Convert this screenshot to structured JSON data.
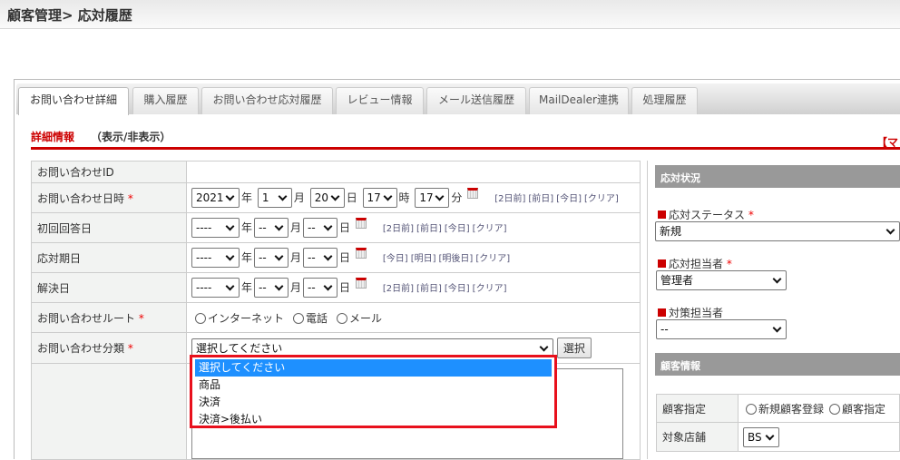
{
  "header": {
    "title": "顧客管理> 応対履歴"
  },
  "tabs": [
    {
      "label": "お問い合わせ詳細"
    },
    {
      "label": "購入履歴"
    },
    {
      "label": "お問い合わせ応対履歴"
    },
    {
      "label": "レビュー情報"
    },
    {
      "label": "メール送信履歴"
    },
    {
      "label": "MailDealer連携"
    },
    {
      "label": "処理履歴"
    }
  ],
  "section": {
    "title": "詳細情報",
    "toggle": "（表示/非表示）",
    "mark": "【マ"
  },
  "units": {
    "year": "年",
    "month": "月",
    "day": "日",
    "hour": "時",
    "minute": "分"
  },
  "form": {
    "id_label": "お問い合わせID",
    "datetime": {
      "label": "お問い合わせ日時",
      "year": "2021",
      "month": "1",
      "day": "20",
      "hour": "17",
      "minute": "17",
      "links": [
        "[2日前]",
        "[前日]",
        "[今日]",
        "[クリア]"
      ]
    },
    "first_reply": {
      "label": "初回回答日",
      "year": "----",
      "month": "--",
      "day": "--",
      "links": [
        "[2日前]",
        "[前日]",
        "[今日]",
        "[クリア]"
      ]
    },
    "due": {
      "label": "応対期日",
      "year": "----",
      "month": "--",
      "day": "--",
      "links": [
        "[今日]",
        "[明日]",
        "[明後日]",
        "[クリア]"
      ]
    },
    "resolved": {
      "label": "解決日",
      "year": "----",
      "month": "--",
      "day": "--",
      "links": [
        "[2日前]",
        "[前日]",
        "[今日]",
        "[クリア]"
      ]
    },
    "route": {
      "label": "お問い合わせルート",
      "options": [
        "インターネット",
        "電話",
        "メール"
      ]
    },
    "category": {
      "label": "お問い合わせ分類",
      "value": "選択してください",
      "button": "選択",
      "options": [
        "選択してください",
        "商品",
        "決済",
        "決済>後払い"
      ]
    },
    "required_mark": "*"
  },
  "right": {
    "status_header": "応対状況",
    "status": {
      "label": "応対ステータス",
      "value": "新規"
    },
    "assignee": {
      "label": "応対担当者",
      "value": "管理者"
    },
    "measure": {
      "label": "対策担当者",
      "value": "--"
    },
    "customer_header": "顧客情報",
    "customer_spec": {
      "label": "顧客指定",
      "options": [
        "新規顧客登録",
        "顧客指定"
      ]
    },
    "store": {
      "label": "対象店舗",
      "value": "BS"
    }
  }
}
